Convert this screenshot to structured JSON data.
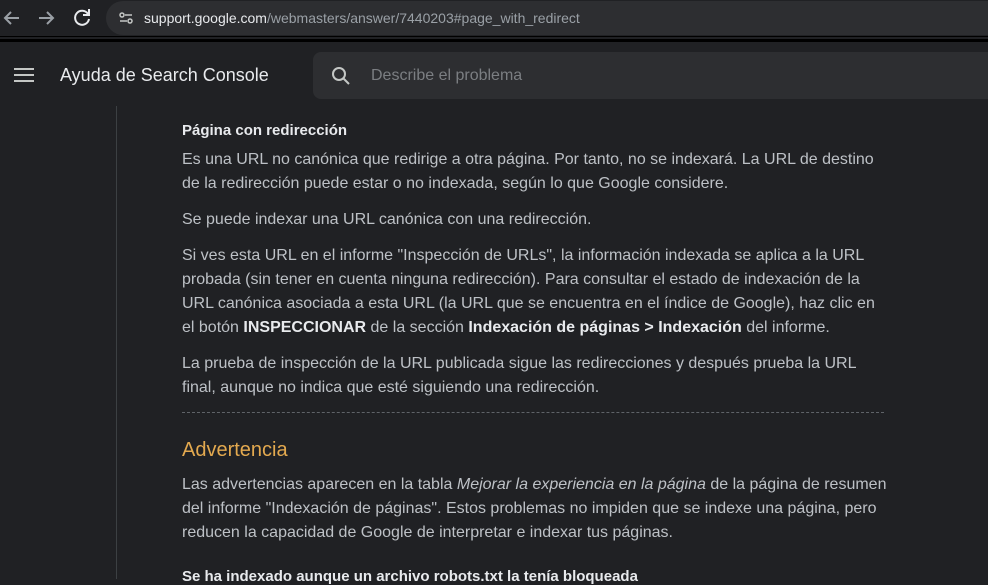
{
  "browser": {
    "url_host": "support.google.com",
    "url_path": "/webmasters/answer/7440203#page_with_redirect"
  },
  "header": {
    "title": "Ayuda de Search Console",
    "search_placeholder": "Describe el problema"
  },
  "article": {
    "subheading": "Página con redirección",
    "p1": "Es una URL no canónica que redirige a otra página. Por tanto, no se indexará. La URL de destino de la redirección puede estar o no indexada, según lo que Google considere.",
    "p2": "Se puede indexar una URL canónica con una redirección.",
    "p3_a": "Si ves esta URL en el informe \"Inspección de URLs\", la información indexada se aplica a la URL probada (sin tener en cuenta ninguna redirección). Para consultar el estado de indexación de la URL canónica asociada a esta URL (la URL que se encuentra en el índice de Google), haz clic en el botón ",
    "p3_bold1": "INSPECCIONAR",
    "p3_b": " de la sección ",
    "p3_bold2": "Indexación de páginas > Indexación",
    "p3_c": " del informe.",
    "p4": "La prueba de inspección de la URL publicada sigue las redirecciones y después prueba la URL final, aunque no indica que esté siguiendo una redirección.",
    "section_heading": "Advertencia",
    "p5_a": "Las advertencias aparecen en la tabla ",
    "p5_italic": "Mejorar la experiencia en la página",
    "p5_b": " de la página de resumen del informe \"Indexación de páginas\". Estos problemas no impiden que se indexe una página, pero reducen la capacidad de Google de interpretar e indexar tus páginas.",
    "subheading2": "Se ha indexado aunque un archivo robots.txt la tenía bloqueada"
  },
  "colors": {
    "background": "#202124",
    "section_heading": "#e3a94f",
    "body_text": "#bdc1c6"
  }
}
